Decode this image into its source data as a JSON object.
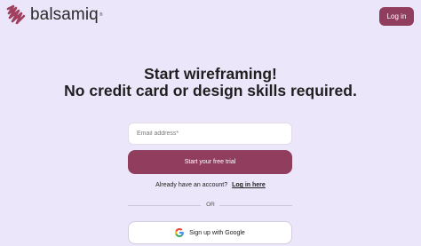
{
  "brand": {
    "name": "balsamiq",
    "trademark": "®",
    "logo_icon": "balsamiq-squiggle-icon",
    "accent_color": "#913e5e"
  },
  "header": {
    "login_label": "Log in"
  },
  "hero": {
    "line1": "Start wireframing!",
    "line2": "No credit card or design skills required."
  },
  "form": {
    "email_placeholder": "Email address*",
    "email_value": "",
    "submit_label": "Start your free trial"
  },
  "account": {
    "prompt": "Already have an account?",
    "login_link": "Log in here"
  },
  "divider": {
    "label": "OR"
  },
  "social": {
    "google_label": "Sign up with Google",
    "google_icon": "google-icon"
  }
}
